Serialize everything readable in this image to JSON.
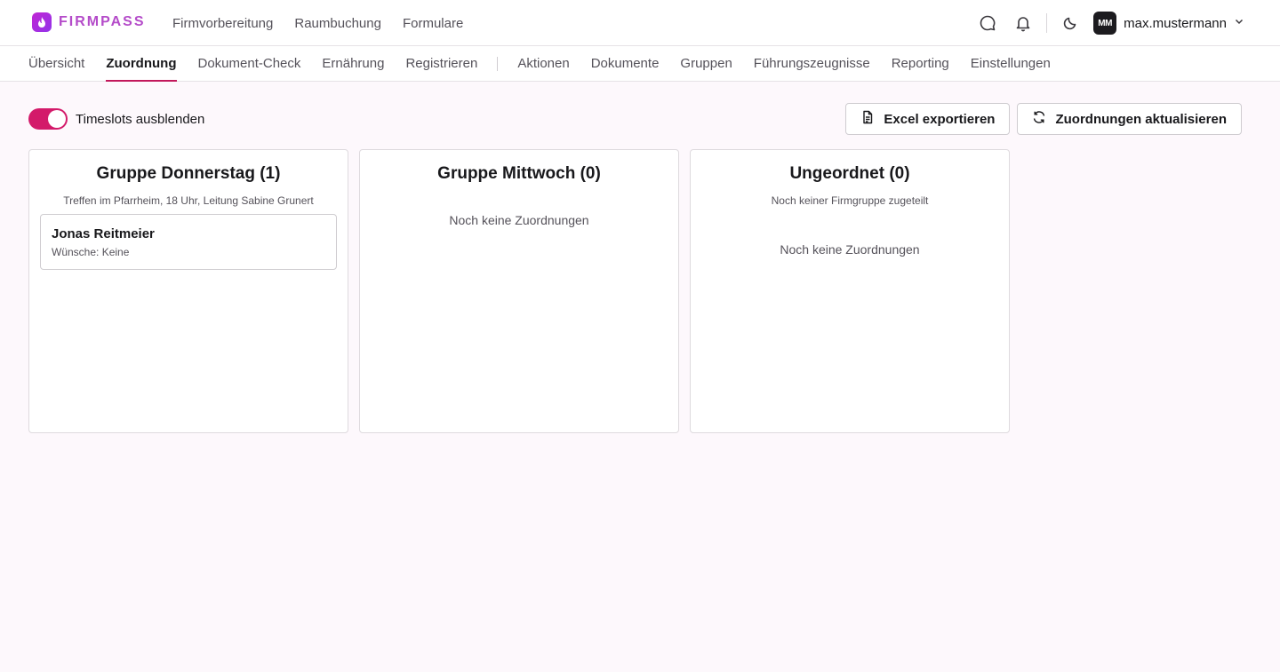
{
  "brand": {
    "name": "FIRMPASS"
  },
  "main_nav": [
    {
      "label": "Firmvorbereitung",
      "active": true
    },
    {
      "label": "Raumbuchung",
      "active": false
    },
    {
      "label": "Formulare",
      "active": false
    }
  ],
  "user": {
    "initials": "MM",
    "name": "max.mustermann"
  },
  "sub_nav": {
    "group1": [
      {
        "label": "Übersicht",
        "active": false
      },
      {
        "label": "Zuordnung",
        "active": true
      },
      {
        "label": "Dokument-Check",
        "active": false
      },
      {
        "label": "Ernährung",
        "active": false
      },
      {
        "label": "Registrieren",
        "active": false
      }
    ],
    "group2": [
      {
        "label": "Aktionen",
        "active": false
      },
      {
        "label": "Dokumente",
        "active": false
      },
      {
        "label": "Gruppen",
        "active": false
      },
      {
        "label": "Führungszeugnisse",
        "active": false
      },
      {
        "label": "Reporting",
        "active": false
      },
      {
        "label": "Einstellungen",
        "active": false
      }
    ]
  },
  "toolbar": {
    "toggle_label": "Timeslots ausblenden",
    "toggle_on": true,
    "export_label": "Excel exportieren",
    "refresh_label": "Zuordnungen aktualisieren"
  },
  "columns": [
    {
      "title": "Gruppe Donnerstag (1)",
      "subtitle": "Treffen im Pfarrheim, 18 Uhr, Leitung Sabine Grunert",
      "empty_text": "",
      "cards": [
        {
          "name": "Jonas Reitmeier",
          "wishes": "Wünsche: Keine"
        }
      ]
    },
    {
      "title": "Gruppe Mittwoch (0)",
      "subtitle": "",
      "empty_text": "Noch keine Zuordnungen",
      "cards": []
    },
    {
      "title": "Ungeordnet (0)",
      "subtitle": "Noch keiner Firmgruppe zugeteilt",
      "empty_text": "Noch keine Zuordnungen",
      "cards": []
    }
  ],
  "colors": {
    "accent": "#d31a6a",
    "brand": "#b44bc9",
    "background": "#fdf8fc"
  }
}
